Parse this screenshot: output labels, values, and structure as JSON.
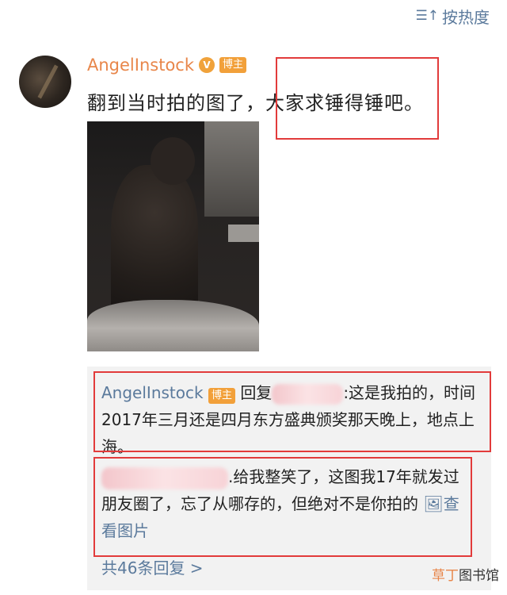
{
  "sort": {
    "icon": "sort-icon",
    "label": "按热度"
  },
  "post": {
    "username": "AngelInstock",
    "owner_badge": "博主",
    "text_before": "翻到当时拍的图了，",
    "text_highlight": "大家求锤得锤吧。",
    "highlight_color": "#e23b3b",
    "accent_color": "#e8864a",
    "link_color": "#5b7a9c"
  },
  "replies": [
    {
      "username": "AngelInstock",
      "badge": "博主",
      "reply_to_prefix": "回复",
      "text": ":这是我拍的，时间2017年三月还是四月东方盛典颁奖那天晚上，地点上海。"
    },
    {
      "text": ".给我整笑了，这图我17年就发过朋友圈了，忘了从哪存的，但绝对不是你拍的",
      "view_image_label": "查看图片"
    }
  ],
  "more_replies": "共46条回复 >",
  "watermark": {
    "part1": "草丁",
    "part2": "图书馆"
  }
}
